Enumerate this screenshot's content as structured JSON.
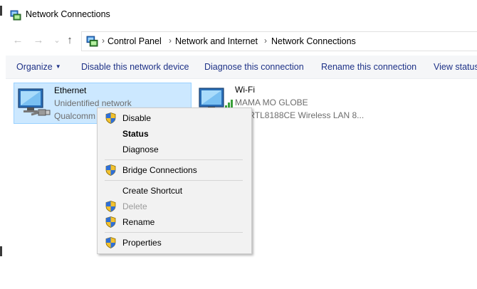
{
  "window": {
    "title": "Network Connections",
    "app_icon": "network-connections-icon"
  },
  "navigation": {
    "back_icon": "←",
    "forward_icon": "→",
    "dropdown_icon": "⌄",
    "up_icon": "↑",
    "separator": "›",
    "breadcrumb": [
      "Control Panel",
      "Network and Internet",
      "Network Connections"
    ]
  },
  "toolbar": {
    "organize": "Organize",
    "organize_caret": "▼",
    "disable": "Disable this network device",
    "diagnose": "Diagnose this connection",
    "rename": "Rename this connection",
    "view_status": "View status"
  },
  "connections": [
    {
      "name": "Ethernet",
      "status": "Unidentified network",
      "device": "Qualcomm",
      "selected": true
    },
    {
      "name": "Wi-Fi",
      "status": "MAMA MO GLOBE",
      "device": "tek RTL8188CE Wireless LAN 8...",
      "selected": false
    }
  ],
  "context_menu": {
    "items": [
      {
        "label": "Disable",
        "shield": true,
        "bold": false,
        "disabled": false
      },
      {
        "label": "Status",
        "shield": false,
        "bold": true,
        "disabled": false
      },
      {
        "label": "Diagnose",
        "shield": false,
        "bold": false,
        "disabled": false
      },
      {
        "label": "Bridge Connections",
        "shield": true,
        "bold": false,
        "disabled": false
      },
      {
        "label": "Create Shortcut",
        "shield": false,
        "bold": false,
        "disabled": false
      },
      {
        "label": "Delete",
        "shield": true,
        "bold": false,
        "disabled": true
      },
      {
        "label": "Rename",
        "shield": true,
        "bold": false,
        "disabled": false
      },
      {
        "label": "Properties",
        "shield": true,
        "bold": false,
        "disabled": false
      }
    ]
  },
  "colors": {
    "selection_bg": "#cce8ff",
    "selection_border": "#99d1ff",
    "toolbar_text": "#1e3287",
    "menu_bg": "#f2f2f2",
    "disabled_text": "#9b9b9b"
  }
}
